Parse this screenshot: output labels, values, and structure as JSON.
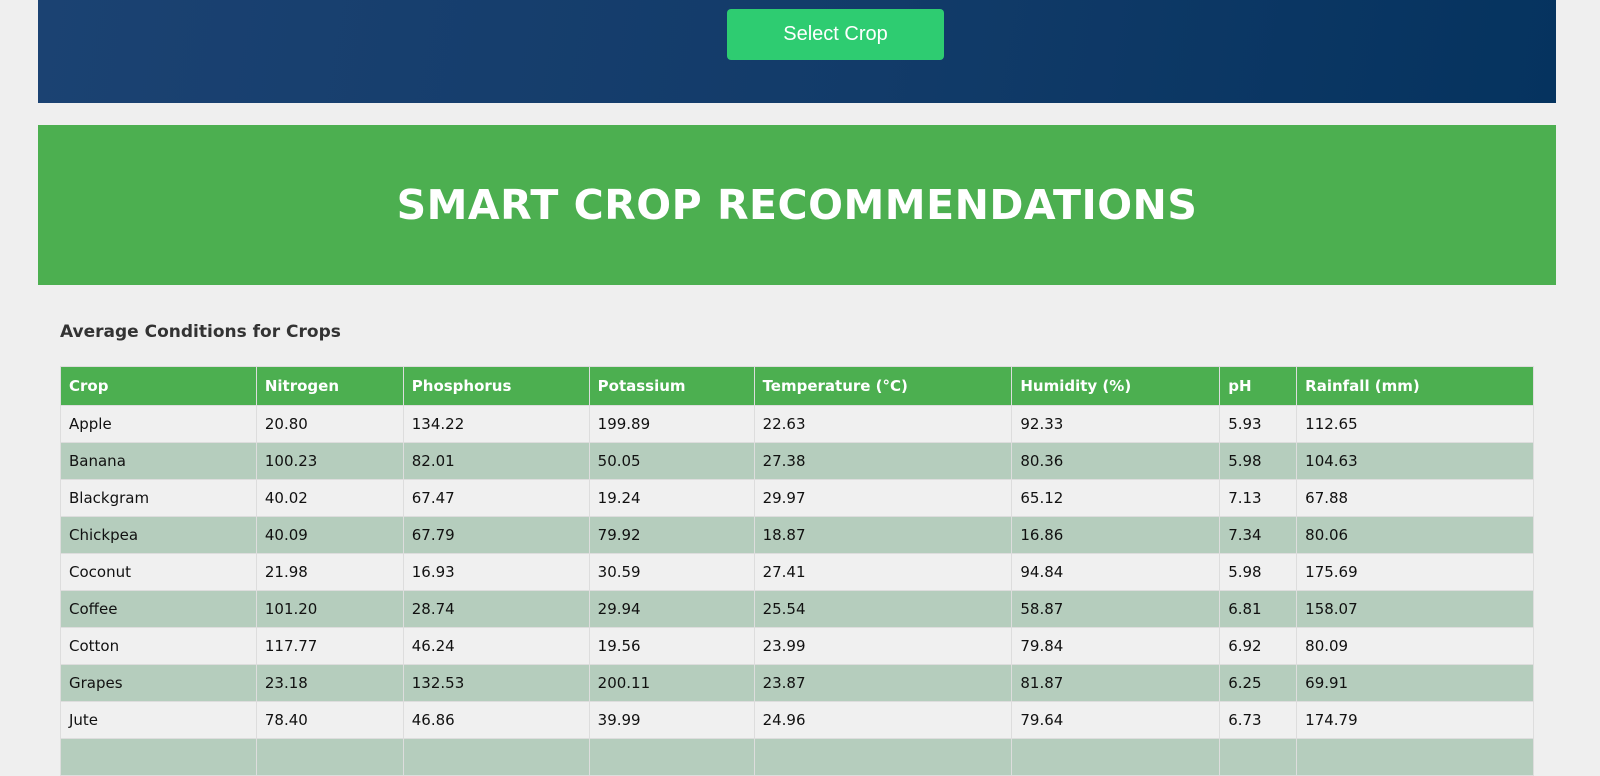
{
  "header": {
    "select_button_label": "Select Crop"
  },
  "hero": {
    "title": "SMART CROP RECOMMENDATIONS"
  },
  "section": {
    "title": "Average Conditions for Crops"
  },
  "table": {
    "columns": [
      "Crop",
      "Nitrogen",
      "Phosphorus",
      "Potassium",
      "Temperature (°C)",
      "Humidity (%)",
      "pH",
      "Rainfall (mm)"
    ],
    "rows": [
      [
        "Apple",
        "20.80",
        "134.22",
        "199.89",
        "22.63",
        "92.33",
        "5.93",
        "112.65"
      ],
      [
        "Banana",
        "100.23",
        "82.01",
        "50.05",
        "27.38",
        "80.36",
        "5.98",
        "104.63"
      ],
      [
        "Blackgram",
        "40.02",
        "67.47",
        "19.24",
        "29.97",
        "65.12",
        "7.13",
        "67.88"
      ],
      [
        "Chickpea",
        "40.09",
        "67.79",
        "79.92",
        "18.87",
        "16.86",
        "7.34",
        "80.06"
      ],
      [
        "Coconut",
        "21.98",
        "16.93",
        "30.59",
        "27.41",
        "94.84",
        "5.98",
        "175.69"
      ],
      [
        "Coffee",
        "101.20",
        "28.74",
        "29.94",
        "25.54",
        "58.87",
        "6.81",
        "158.07"
      ],
      [
        "Cotton",
        "117.77",
        "46.24",
        "19.56",
        "23.99",
        "79.84",
        "6.92",
        "80.09"
      ],
      [
        "Grapes",
        "23.18",
        "132.53",
        "200.11",
        "23.87",
        "81.87",
        "6.25",
        "69.91"
      ],
      [
        "Jute",
        "78.40",
        "46.86",
        "39.99",
        "24.96",
        "79.64",
        "6.73",
        "174.79"
      ]
    ]
  },
  "colors": {
    "banner_start": "#1b4272",
    "banner_end": "#05335f",
    "button": "#2ecc71",
    "hero": "#4caf50",
    "row_alt": "#b5cdbd"
  }
}
